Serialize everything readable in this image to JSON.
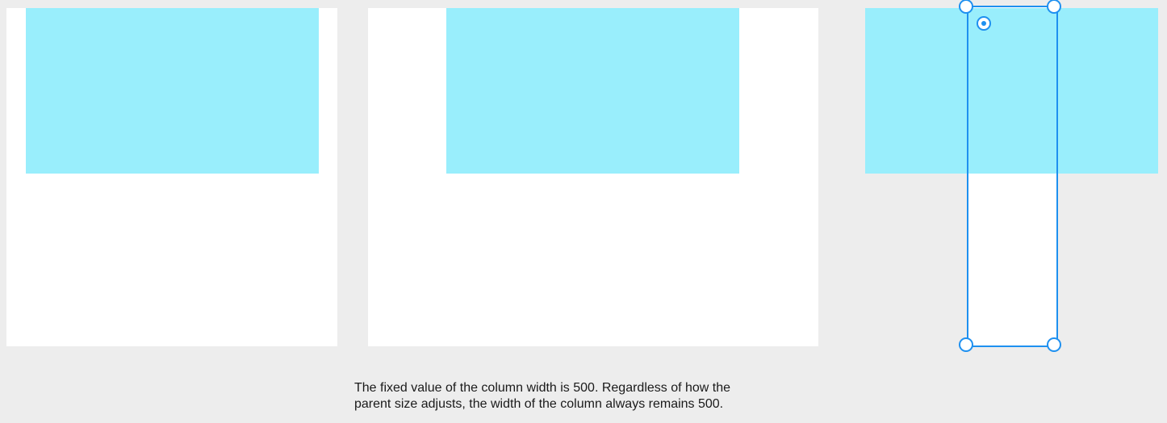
{
  "caption": {
    "line1": "The fixed value of the column width is 500. Regardless of how the",
    "line2": "parent size adjusts, the width of the column always remains 500."
  },
  "colors": {
    "canvas": "#ededed",
    "frame": "#ffffff",
    "column": "#99eefc",
    "selection": "#1e90f0"
  },
  "icons": {
    "handle": "resize-handle-icon",
    "target": "target-icon"
  }
}
